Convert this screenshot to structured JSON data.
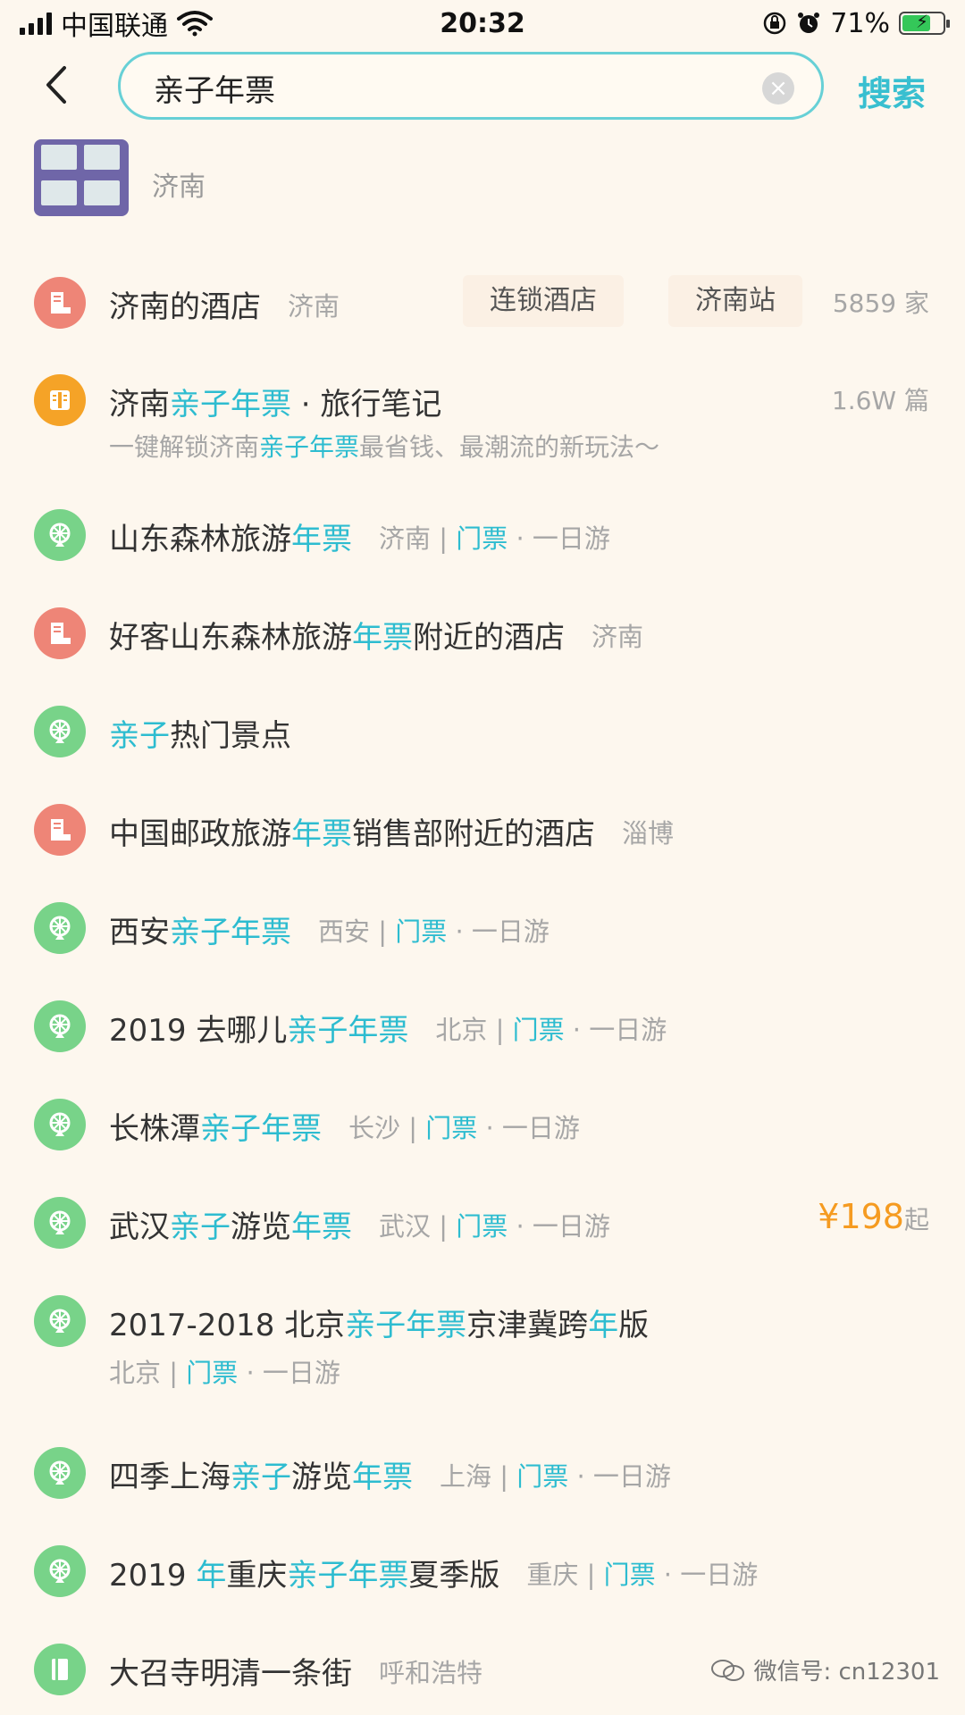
{
  "status_bar": {
    "carrier": "中国联通",
    "time": "20:32",
    "battery_percent": "71%",
    "battery_level": 0.71
  },
  "search": {
    "query": "亲子年票",
    "button_label": "搜索"
  },
  "thumb_row": {
    "caption": "济南"
  },
  "suggestions": [
    {
      "type": "hotel",
      "title": [
        [
          "济南的酒店",
          ""
        ]
      ],
      "location": "济南",
      "tags": [
        "连锁酒店",
        "济南站"
      ],
      "count": "5859 家"
    },
    {
      "type": "note",
      "title": [
        [
          "济南",
          ""
        ],
        [
          "亲子年票",
          "hl"
        ],
        [
          " · 旅行笔记",
          ""
        ]
      ],
      "count": "1.6W 篇",
      "subtitle": [
        [
          "一键解锁济南",
          ""
        ],
        [
          "亲子年票",
          "hl"
        ],
        [
          "最省钱、最潮流的新玩法～",
          ""
        ]
      ]
    },
    {
      "type": "spot",
      "title": [
        [
          "山东森林旅游",
          ""
        ],
        [
          "年票",
          "hl"
        ]
      ],
      "location": "济南",
      "category": "门票",
      "duration": "一日游"
    },
    {
      "type": "hotel",
      "title": [
        [
          "好客山东森林旅游",
          ""
        ],
        [
          "年票",
          "hl"
        ],
        [
          "附近的酒店",
          ""
        ]
      ],
      "location": "济南"
    },
    {
      "type": "spot",
      "title": [
        [
          "亲子",
          "hl"
        ],
        [
          "热门景点",
          ""
        ]
      ]
    },
    {
      "type": "hotel",
      "title": [
        [
          "中国邮政旅游",
          ""
        ],
        [
          "年票",
          "hl"
        ],
        [
          "销售部附近的酒店",
          ""
        ]
      ],
      "location": "淄博"
    },
    {
      "type": "spot",
      "title": [
        [
          "西安",
          ""
        ],
        [
          "亲子年票",
          "hl"
        ]
      ],
      "location": "西安",
      "category": "门票",
      "duration": "一日游"
    },
    {
      "type": "spot",
      "title": [
        [
          "2019 去哪儿",
          ""
        ],
        [
          "亲子年票",
          "hl"
        ]
      ],
      "location": "北京",
      "category": "门票",
      "duration": "一日游"
    },
    {
      "type": "spot",
      "title": [
        [
          "长株潭",
          ""
        ],
        [
          "亲子年票",
          "hl"
        ]
      ],
      "location": "长沙",
      "category": "门票",
      "duration": "一日游"
    },
    {
      "type": "spot",
      "title": [
        [
          "武汉",
          ""
        ],
        [
          "亲子",
          "hl"
        ],
        [
          "游览",
          ""
        ],
        [
          "年票",
          "hl"
        ]
      ],
      "location": "武汉",
      "category": "门票",
      "duration": "一日游",
      "price": "¥198",
      "price_suffix": "起"
    },
    {
      "type": "spot",
      "title": [
        [
          "2017-2018 北京",
          ""
        ],
        [
          "亲子年票",
          "hl"
        ],
        [
          "京津冀跨",
          ""
        ],
        [
          "年",
          "hl"
        ],
        [
          "版",
          ""
        ]
      ],
      "location": "北京",
      "category": "门票",
      "duration": "一日游",
      "meta_below": true
    },
    {
      "type": "spot",
      "title": [
        [
          "四季上海",
          ""
        ],
        [
          "亲子",
          "hl"
        ],
        [
          "游览",
          ""
        ],
        [
          "年票",
          "hl"
        ]
      ],
      "location": "上海",
      "category": "门票",
      "duration": "一日游"
    },
    {
      "type": "spot",
      "title": [
        [
          "2019 ",
          ""
        ],
        [
          "年",
          "hl"
        ],
        [
          "重庆",
          ""
        ],
        [
          "亲子年票",
          "hl"
        ],
        [
          "夏季版",
          ""
        ]
      ],
      "location": "重庆",
      "category": "门票",
      "duration": "一日游"
    },
    {
      "type": "spot-book",
      "title": [
        [
          "大召寺明清一条街",
          ""
        ]
      ],
      "location": "呼和浩特"
    }
  ],
  "watermark": "微信号: cn12301",
  "colors": {
    "accent": "#2dbcd0",
    "price": "#f59b21",
    "hotel": "#ee8577",
    "spot": "#78d389",
    "note": "#f5a327"
  }
}
